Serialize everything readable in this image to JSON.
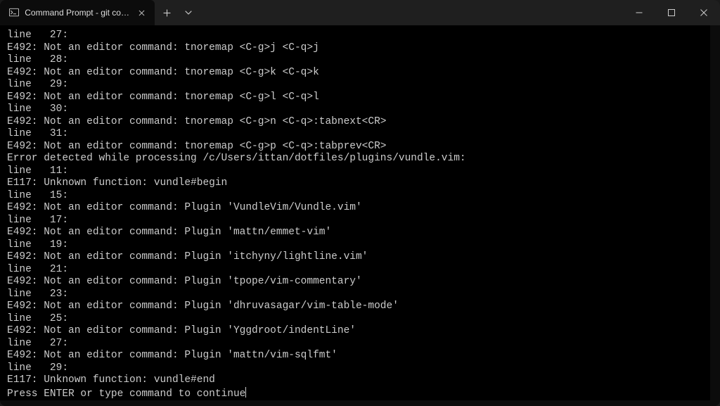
{
  "titlebar": {
    "tab_title": "Command Prompt - git comm",
    "tab_icon": "terminal-icon",
    "new_tab_label": "+",
    "dropdown_label": "v"
  },
  "window_controls": {
    "minimize_aria": "Minimize",
    "maximize_aria": "Maximize",
    "close_aria": "Close"
  },
  "terminal": {
    "lines": [
      "line   27:",
      "E492: Not an editor command: tnoremap <C-g>j <C-q>j",
      "line   28:",
      "E492: Not an editor command: tnoremap <C-g>k <C-q>k",
      "line   29:",
      "E492: Not an editor command: tnoremap <C-g>l <C-q>l",
      "line   30:",
      "E492: Not an editor command: tnoremap <C-g>n <C-q>:tabnext<CR>",
      "line   31:",
      "E492: Not an editor command: tnoremap <C-g>p <C-q>:tabprev<CR>",
      "Error detected while processing /c/Users/ittan/dotfiles/plugins/vundle.vim:",
      "line   11:",
      "E117: Unknown function: vundle#begin",
      "line   15:",
      "E492: Not an editor command: Plugin 'VundleVim/Vundle.vim'",
      "line   17:",
      "E492: Not an editor command: Plugin 'mattn/emmet-vim'",
      "line   19:",
      "E492: Not an editor command: Plugin 'itchyny/lightline.vim'",
      "line   21:",
      "E492: Not an editor command: Plugin 'tpope/vim-commentary'",
      "line   23:",
      "E492: Not an editor command: Plugin 'dhruvasagar/vim-table-mode'",
      "line   25:",
      "E492: Not an editor command: Plugin 'Yggdroot/indentLine'",
      "line   27:",
      "E492: Not an editor command: Plugin 'mattn/vim-sqlfmt'",
      "line   29:",
      "E117: Unknown function: vundle#end"
    ],
    "prompt": "Press ENTER or type command to continue"
  }
}
